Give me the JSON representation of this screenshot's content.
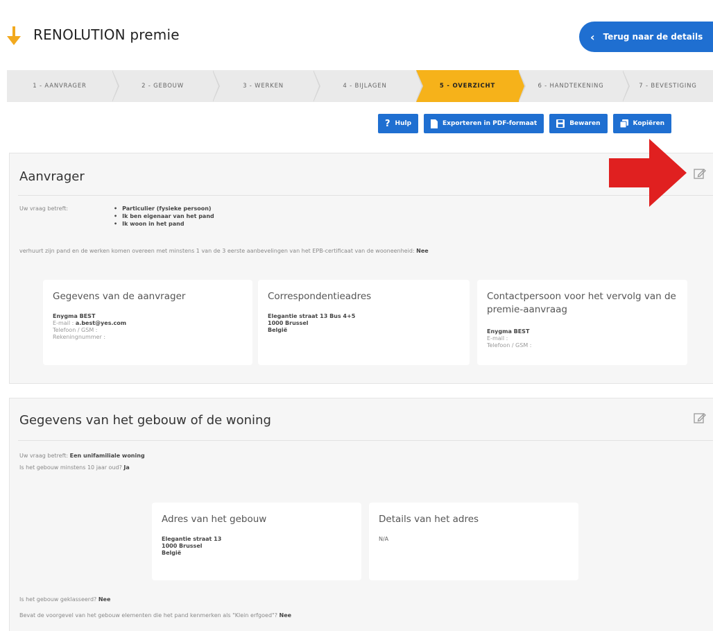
{
  "header": {
    "app_title": "RENOLUTION premie",
    "back_label": "Terug naar de details"
  },
  "colors": {
    "brand_blue": "#1f6fd1",
    "active_step": "#f6b21a",
    "logo_orange": "#f2a91e",
    "highlight_arrow": "#e02020"
  },
  "steps": [
    {
      "label": "1 - AANVRAGER",
      "active": false
    },
    {
      "label": "2 - GEBOUW",
      "active": false
    },
    {
      "label": "3 - WERKEN",
      "active": false
    },
    {
      "label": "4 - BIJLAGEN",
      "active": false
    },
    {
      "label": "5 - OVERZICHT",
      "active": true
    },
    {
      "label": "6 - HANDTEKENING",
      "active": false
    },
    {
      "label": "7 - BEVESTIGING",
      "active": false
    }
  ],
  "toolbar": {
    "help_label": "Hulp",
    "export_label": "Exporteren in PDF-formaat",
    "save_label": "Bewaren",
    "copy_label": "Kopiëren"
  },
  "aanvrager": {
    "title": "Aanvrager",
    "question_label": "Uw vraag betreft:",
    "bullets": [
      "Particulier (fysieke persoon)",
      "Ik ben eigenaar van het pand",
      "Ik woon in het pand"
    ],
    "rental_text": "verhuurt zijn pand en de werken komen overeen met minstens 1 van de 3 eerste aanbevelingen van het EPB-certificaat van de wooneenheid:",
    "rental_value": "Nee",
    "cards": {
      "applicant": {
        "title": "Gegevens van de aanvrager",
        "name": "Enygma BEST",
        "email_label": "E-mail :",
        "email_value": "a.best@yes.com",
        "phone_label": "Telefoon / GSM :",
        "account_label": "Rekeningnummer :"
      },
      "correspondence": {
        "title": "Correspondentieadres",
        "street": "Elegantie straat 13 Bus 4+5",
        "city": "1000 Brussel",
        "country": "België"
      },
      "contact": {
        "title": "Contactpersoon voor het vervolg van de premie-aanvraag",
        "name": "Enygma BEST",
        "email_label": "E-mail :",
        "phone_label": "Telefoon / GSM :"
      }
    }
  },
  "gebouw": {
    "title": "Gegevens van het gebouw of de woning",
    "question_label": "Uw vraag betreft:",
    "question_value": "Een unifamiliale woning",
    "age_label": "Is het gebouw minstens 10 jaar oud?",
    "age_value": "Ja",
    "cards": {
      "address": {
        "title": "Adres van het gebouw",
        "street": "Elegantie straat 13",
        "city": "1000 Brussel",
        "country": "België"
      },
      "details": {
        "title": "Details van het adres",
        "value": "N/A"
      }
    },
    "classified_label": "Is het gebouw geklasseerd?",
    "classified_value": "Nee",
    "heritage_label": "Bevat de voorgevel van het gebouw elementen die het pand kenmerken als \"Klein erfgoed\"?",
    "heritage_value": "Nee"
  }
}
